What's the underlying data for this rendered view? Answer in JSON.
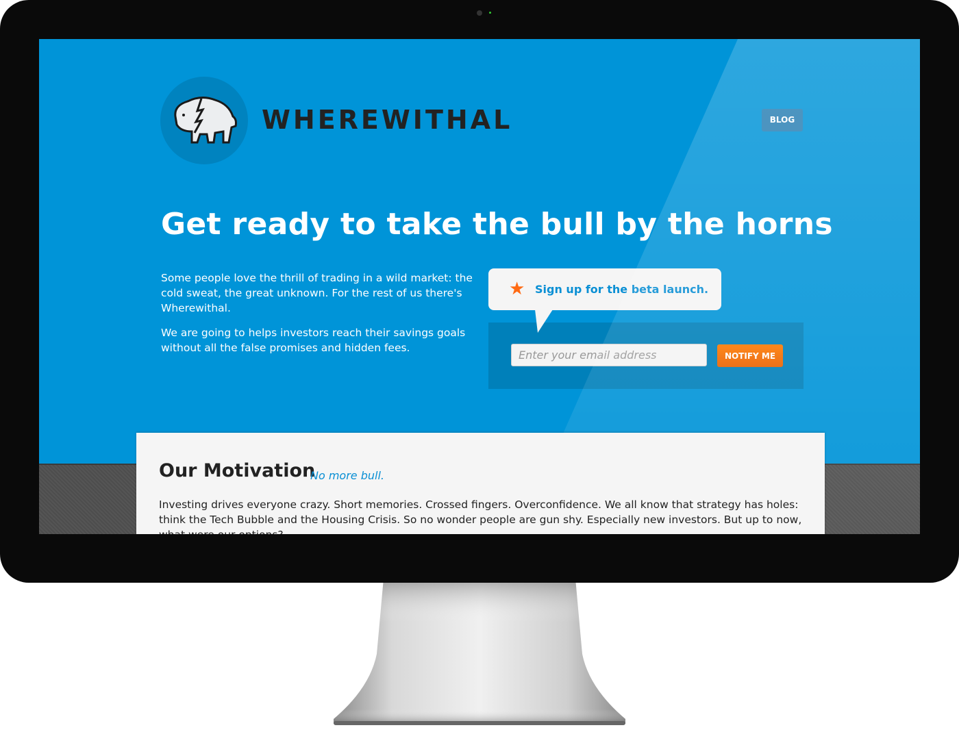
{
  "header": {
    "brand": "WHEREWITHAL",
    "blog_label": "BLOG"
  },
  "hero": {
    "headline": "Get ready to take the bull by the horns",
    "paragraphs": [
      "Some people love the thrill of trading in a wild market: the cold sweat, the great unknown.  For the rest of us there's Wherewithal.",
      "We are going to helps investors reach their savings goals without all the false promises and hidden fees."
    ]
  },
  "signup": {
    "prompt": "Sign up for the beta launch.",
    "email_placeholder": "Enter your email address",
    "email_value": "",
    "button_label": "NOTIFY ME",
    "icon": "star-icon"
  },
  "motivation": {
    "title": "Our Motivation",
    "tagline": "No more bull.",
    "body": "Investing drives everyone crazy. Short memories.  Crossed fingers.  Overconfidence.  We all know that strategy has holes: think the Tech Bubble and the Housing Crisis. So no wonder people are gun shy.  Especially new investors. But up to now, what were our options?"
  },
  "colors": {
    "brand_blue": "#0094d8",
    "accent_orange": "#ff7a00",
    "link_blue": "#0a8fd4"
  }
}
